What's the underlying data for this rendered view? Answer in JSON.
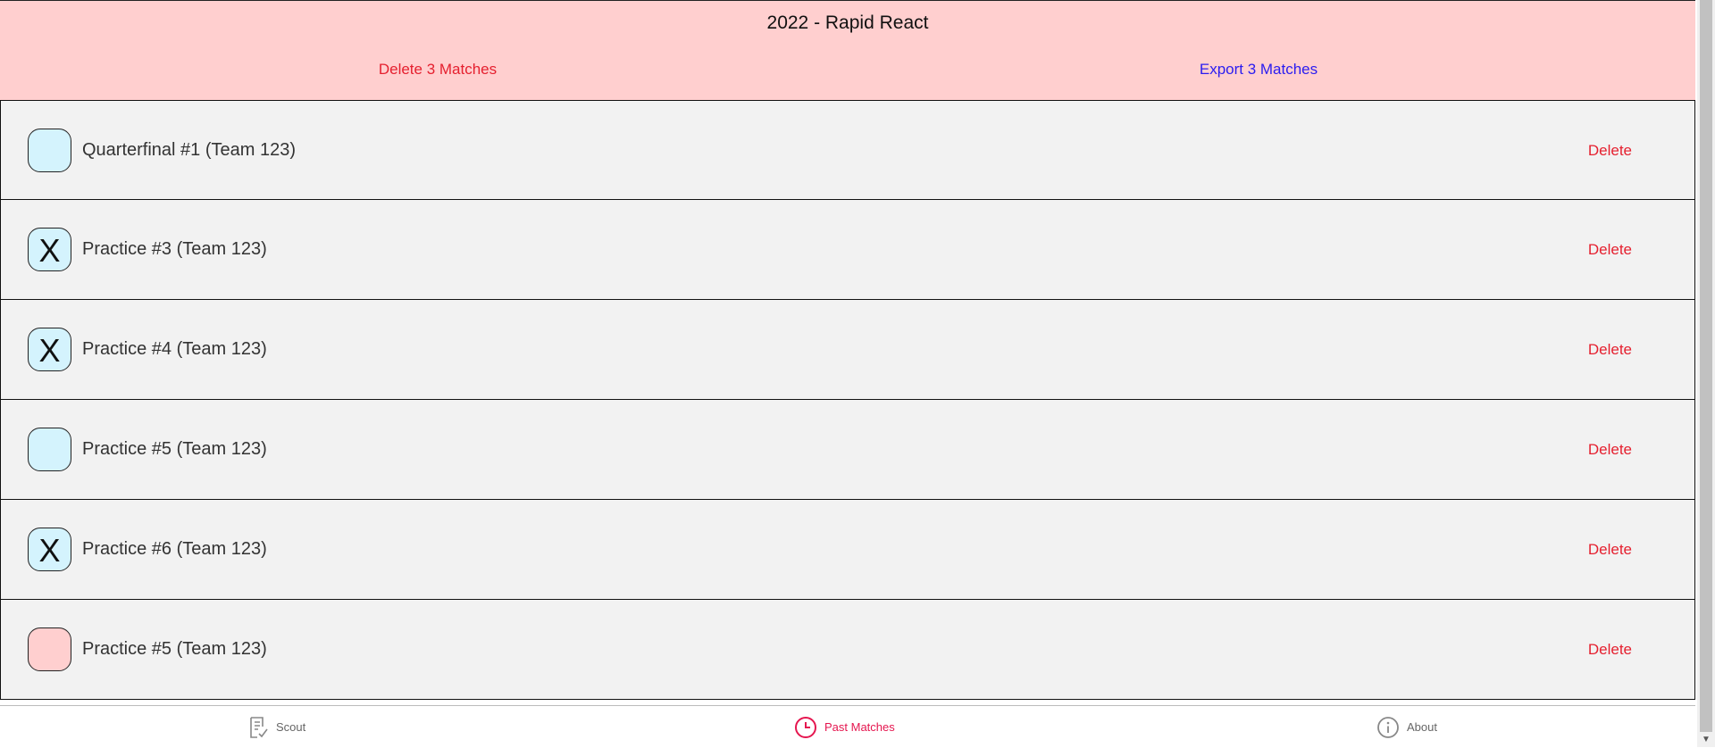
{
  "header": {
    "title": "2022 - Rapid React",
    "delete_label": "Delete 3 Matches",
    "export_label": "Export 3 Matches"
  },
  "matches": [
    {
      "label": "Quarterfinal #1 (Team 123)",
      "mark": "",
      "color": "#d4f3fd",
      "delete_label": "Delete"
    },
    {
      "label": "Practice #3 (Team 123)",
      "mark": "X",
      "color": "#d4f3fd",
      "delete_label": "Delete"
    },
    {
      "label": "Practice #4 (Team 123)",
      "mark": "X",
      "color": "#d4f3fd",
      "delete_label": "Delete"
    },
    {
      "label": "Practice #5 (Team 123)",
      "mark": "",
      "color": "#d4f3fd",
      "delete_label": "Delete"
    },
    {
      "label": "Practice #6 (Team 123)",
      "mark": "X",
      "color": "#d4f3fd",
      "delete_label": "Delete"
    },
    {
      "label": "Practice #5 (Team 123)",
      "mark": "",
      "color": "#ffcfcf",
      "delete_label": "Delete"
    }
  ],
  "tabs": [
    {
      "label": "Scout",
      "icon": "clipboard-check-icon"
    },
    {
      "label": "Past Matches",
      "icon": "clock-icon",
      "active": true
    },
    {
      "label": "About",
      "icon": "info-icon"
    }
  ],
  "colors": {
    "header_bg": "#ffcfcf",
    "delete_red": "#e5202f",
    "export_blue": "#2a1cf0",
    "active_tab": "#e5164f"
  }
}
